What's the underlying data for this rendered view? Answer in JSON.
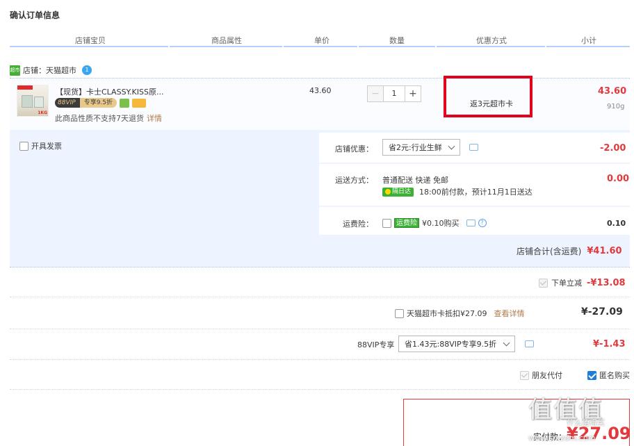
{
  "page_title": "确认订单信息",
  "columns": [
    "店铺宝贝",
    "商品属性",
    "单价",
    "数量",
    "优惠方式",
    "小计"
  ],
  "shop": {
    "icon_text": "超市",
    "label": "店铺：天猫超市",
    "ww_text": "1"
  },
  "item": {
    "title": "【现货】卡士CLASSY.KISS原...",
    "vip_label": "88VIP",
    "vip_discount": "专享9.5折",
    "note": "此商品性质不支持7天退货",
    "note_link": "详情",
    "unit_price": "43.60",
    "quantity": "1",
    "promo": "返3元超市卡",
    "subtotal": "43.60",
    "weight": "910g",
    "thumb_tag": "1KG"
  },
  "invoice_label": "开具发票",
  "shop_discount": {
    "label": "店铺优惠：",
    "selected": "省2元:行业生鲜",
    "amount": "-2.00"
  },
  "shipping": {
    "label": "运送方式：",
    "method": "普通配送 快递 免邮",
    "badge": "隔日达",
    "eta": "18:00前付款，预计11月1日送达",
    "amount": "0.00"
  },
  "insurance": {
    "label": "运费险：",
    "tag": "运费险",
    "price": "¥0.10购买",
    "amount": "0.10"
  },
  "shop_total": {
    "label": "店铺合计(含运费)",
    "amount": "¥41.60"
  },
  "order_discount": {
    "label": "下单立减",
    "amount": "-¥13.08"
  },
  "supermarket_card": {
    "label": "天猫超市卡抵扣¥27.09",
    "link": "查看详情",
    "amount": "¥-27.09"
  },
  "vip": {
    "label": "88VIP专享",
    "selected": "省1.43元:88VIP专享9.5折",
    "amount": "¥-1.43"
  },
  "friend_pay_label": "朋友代付",
  "anonymous_label": "匿名购买",
  "final": {
    "label": "实付款：",
    "amount": "¥27.09"
  },
  "watermark": {
    "main": "值值值",
    "sub": "什么值得买",
    "url": "www.smzdm.com"
  },
  "colors": {
    "accent_red": "#e4393c",
    "highlight_box": "#e3001b",
    "panel_bg": "#eef4ff",
    "link_blue": "#1e7dd6"
  }
}
